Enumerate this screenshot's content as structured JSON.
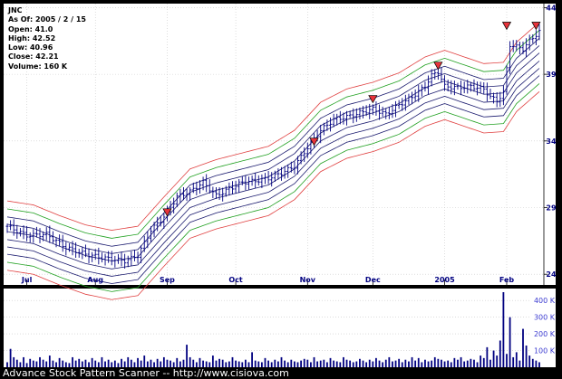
{
  "info": {
    "ticker": "JNC",
    "as_of": "As Of: 2005 / 2 / 15",
    "open": "Open: 41.0",
    "high": "High: 42.52",
    "low": "Low: 40.96",
    "close": "Close: 42.21",
    "volume": "Volume: 160 K"
  },
  "footer": "Advance Stock Pattern Scanner -- http://www.cisiova.com",
  "colors": {
    "background": "#000000",
    "panel": "#ffffff",
    "price_bar": "#000080",
    "volume_bar": "#000080",
    "band_red": "#e04040",
    "band_green": "#20a020",
    "band_navy": "#1a1a6e",
    "marker": "#e8333a",
    "axis_label": "#000080",
    "volume_label": "#3b3bd0"
  },
  "chart_data": [
    {
      "type": "ohlc",
      "title": "JNC",
      "y_ticks": [
        24,
        29,
        34,
        39,
        44
      ],
      "ylim": [
        23.2,
        44.3
      ],
      "x_labels": [
        "Jul",
        "Aug",
        "Sep",
        "Oct",
        "Nov",
        "Dec",
        "2005",
        "Feb"
      ],
      "x_label_positions": [
        6,
        27,
        49,
        70,
        92,
        112,
        134,
        153
      ],
      "n_bars": 164,
      "close_anchors": [
        [
          0,
          27.6
        ],
        [
          6,
          26.9
        ],
        [
          12,
          27.0
        ],
        [
          18,
          26.0
        ],
        [
          24,
          25.5
        ],
        [
          30,
          25.2
        ],
        [
          36,
          25.0
        ],
        [
          40,
          25.4
        ],
        [
          44,
          27.3
        ],
        [
          48,
          28.3
        ],
        [
          52,
          29.8
        ],
        [
          56,
          30.2
        ],
        [
          60,
          30.9
        ],
        [
          64,
          29.9
        ],
        [
          68,
          30.4
        ],
        [
          72,
          30.9
        ],
        [
          76,
          31.0
        ],
        [
          80,
          31.2
        ],
        [
          84,
          31.6
        ],
        [
          88,
          32.1
        ],
        [
          92,
          33.5
        ],
        [
          96,
          34.8
        ],
        [
          100,
          35.6
        ],
        [
          104,
          35.8
        ],
        [
          108,
          36.1
        ],
        [
          112,
          36.4
        ],
        [
          116,
          36.0
        ],
        [
          120,
          36.7
        ],
        [
          124,
          37.3
        ],
        [
          128,
          38.1
        ],
        [
          130,
          38.9
        ],
        [
          132,
          39.2
        ],
        [
          134,
          38.1
        ],
        [
          138,
          38.0
        ],
        [
          142,
          38.1
        ],
        [
          146,
          37.9
        ],
        [
          148,
          37.3
        ],
        [
          150,
          37.0
        ],
        [
          152,
          37.6
        ],
        [
          154,
          41.2
        ],
        [
          158,
          40.9
        ],
        [
          160,
          41.5
        ],
        [
          163,
          42.2
        ]
      ],
      "bands_center_anchors": [
        [
          0,
          26.9
        ],
        [
          8,
          26.6
        ],
        [
          16,
          25.8
        ],
        [
          24,
          25.1
        ],
        [
          32,
          24.7
        ],
        [
          40,
          25.0
        ],
        [
          48,
          27.2
        ],
        [
          56,
          29.3
        ],
        [
          64,
          30.0
        ],
        [
          72,
          30.5
        ],
        [
          80,
          31.0
        ],
        [
          88,
          32.2
        ],
        [
          96,
          34.3
        ],
        [
          104,
          35.3
        ],
        [
          112,
          35.8
        ],
        [
          120,
          36.5
        ],
        [
          128,
          37.7
        ],
        [
          134,
          38.2
        ],
        [
          140,
          37.7
        ],
        [
          146,
          37.2
        ],
        [
          152,
          37.3
        ],
        [
          156,
          38.8
        ],
        [
          163,
          40.3
        ]
      ],
      "band_offsets": [
        2.6,
        2.0,
        1.4,
        0.85,
        0.3,
        -0.3,
        -0.85,
        -1.4,
        -2.0,
        -2.6
      ],
      "band_colors": [
        "red",
        "green",
        "navy",
        "navy",
        "navy",
        "navy",
        "navy",
        "navy",
        "green",
        "red"
      ],
      "markers": [
        {
          "bar": 49,
          "value": 28.3
        },
        {
          "bar": 94,
          "value": 33.6
        },
        {
          "bar": 112,
          "value": 36.8
        },
        {
          "bar": 132,
          "value": 39.3
        },
        {
          "bar": 153,
          "value": 42.3
        },
        {
          "bar": 162,
          "value": 42.3
        }
      ]
    },
    {
      "type": "bar",
      "title": "Volume",
      "y_ticks": [
        100,
        200,
        300,
        400
      ],
      "y_tick_labels": [
        "100 K",
        "200 K",
        "300 K",
        "400 K"
      ],
      "ylim": [
        0,
        450
      ],
      "n_bars": 164,
      "values": [
        30,
        110,
        60,
        45,
        30,
        60,
        25,
        50,
        40,
        35,
        60,
        45,
        35,
        70,
        40,
        30,
        55,
        40,
        30,
        25,
        60,
        40,
        50,
        35,
        45,
        30,
        55,
        40,
        30,
        60,
        35,
        45,
        30,
        40,
        25,
        50,
        35,
        60,
        45,
        30,
        55,
        40,
        70,
        35,
        45,
        30,
        50,
        35,
        60,
        45,
        40,
        30,
        55,
        35,
        45,
        135,
        60,
        45,
        30,
        55,
        40,
        35,
        30,
        70,
        40,
        50,
        45,
        30,
        35,
        60,
        40,
        35,
        30,
        45,
        30,
        90,
        40,
        35,
        30,
        55,
        40,
        30,
        45,
        35,
        60,
        40,
        30,
        45,
        35,
        30,
        40,
        50,
        45,
        30,
        60,
        35,
        40,
        45,
        30,
        55,
        40,
        35,
        30,
        60,
        45,
        40,
        30,
        35,
        50,
        40,
        30,
        45,
        35,
        55,
        40,
        30,
        45,
        60,
        35,
        40,
        50,
        30,
        45,
        35,
        60,
        40,
        55,
        30,
        45,
        35,
        40,
        60,
        50,
        45,
        35,
        40,
        30,
        55,
        45,
        60,
        35,
        40,
        50,
        45,
        30,
        70,
        55,
        120,
        45,
        100,
        70,
        160,
        450,
        80,
        300,
        60,
        90,
        40,
        230,
        130,
        70,
        50,
        40,
        30
      ]
    }
  ]
}
